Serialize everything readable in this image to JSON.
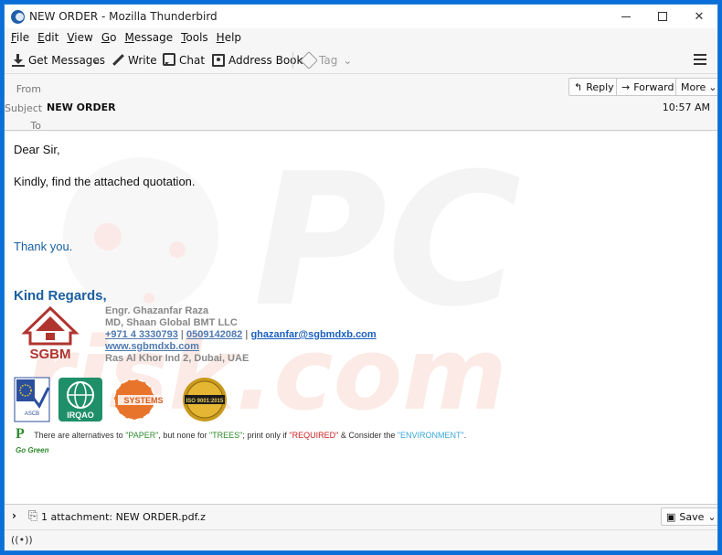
{
  "window": {
    "title": "NEW ORDER - Mozilla Thunderbird"
  },
  "menu": [
    {
      "label": "File",
      "key": "F"
    },
    {
      "label": "Edit",
      "key": "E"
    },
    {
      "label": "View",
      "key": "V"
    },
    {
      "label": "Go",
      "key": "G"
    },
    {
      "label": "Message",
      "key": "M"
    },
    {
      "label": "Tools",
      "key": "T"
    },
    {
      "label": "Help",
      "key": "H"
    }
  ],
  "toolbar": {
    "get_messages": "Get Messages",
    "write": "Write",
    "chat": "Chat",
    "address_book": "Address Book",
    "tag": "Tag"
  },
  "header": {
    "from_label": "From",
    "subject_label": "Subject",
    "subject": "NEW ORDER",
    "to_label": "To",
    "time": "10:57 AM",
    "reply": "Reply",
    "forward": "Forward",
    "more": "More"
  },
  "message": {
    "greeting": "Dear Sir,",
    "line1": "Kindly, find the attached quotation.",
    "thanks": "Thank you.",
    "regards": "Kind Regards,",
    "logo_text": "SGBM",
    "sig_name": "Engr. Ghazanfar Raza",
    "sig_title": "MD, Shaan Global BMT LLC",
    "sig_phone1": "+971 4 3330793",
    "sig_sep1": " | ",
    "sig_phone2": "0509142082",
    "sig_sep2": " | ",
    "sig_email": " ghazanfar@sgbmdxb.com",
    "sig_web": "www.sgbmdxb.com",
    "sig_address": "Ras Al  Khor Ind 2, Dubai, UAE",
    "cert_labels": [
      "ASCB",
      "IRQAO",
      "SYSTEMS",
      "ISO 9001:2015"
    ],
    "green_p": "P",
    "green_t1": "There are alternatives to ",
    "green_paper": "\"PAPER\"",
    "green_t2": ", but none for ",
    "green_trees": "\"TREES\"",
    "green_t3": "; print only if ",
    "green_required": "\"REQUIRED\"",
    "green_t4": " & Consider the ",
    "green_env": "\"ENVIRONMENT\"",
    "green_t5": ".",
    "gogreen": "Go Green"
  },
  "attachment": {
    "text": "1 attachment: NEW ORDER.pdf.z",
    "save": "Save"
  }
}
